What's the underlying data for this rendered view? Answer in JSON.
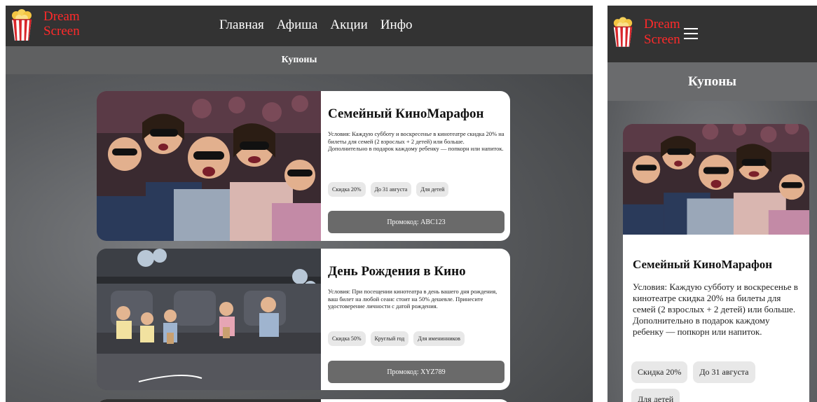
{
  "brand": {
    "line1": "Dream",
    "line2": "Screen",
    "color": "#ff2a2a"
  },
  "nav": [
    "Главная",
    "Афиша",
    "Акции",
    "Инфо"
  ],
  "page_title": "Купоны",
  "coupons": [
    {
      "title": "Семейный КиноМарафон",
      "conditions": "Условия: Каждую субботу и воскресенье в кинотеатре скидка 20% на билеты для семей (2 взрослых + 2 детей) или больше. Дополнительно в подарок каждому ребенку — попкорн или напиток.",
      "tags": [
        "Скидка 20%",
        "До 31 августа",
        "Для детей"
      ],
      "promo": "Промокод: ABC123"
    },
    {
      "title": "День Рождения в Кино",
      "conditions": "Условия: При посещении кинотеатра в день вашего дня рождения, ваш билет на любой сеанс стоит на 50% дешевле. Принесите удостоверение личности с датой рождения.",
      "tags": [
        "Скидка 50%",
        "Круглый год",
        "Для именинников"
      ],
      "promo": "Промокод: XYZ789"
    }
  ],
  "icons": {
    "logo": "popcorn-icon",
    "menu": "hamburger-menu-icon"
  }
}
